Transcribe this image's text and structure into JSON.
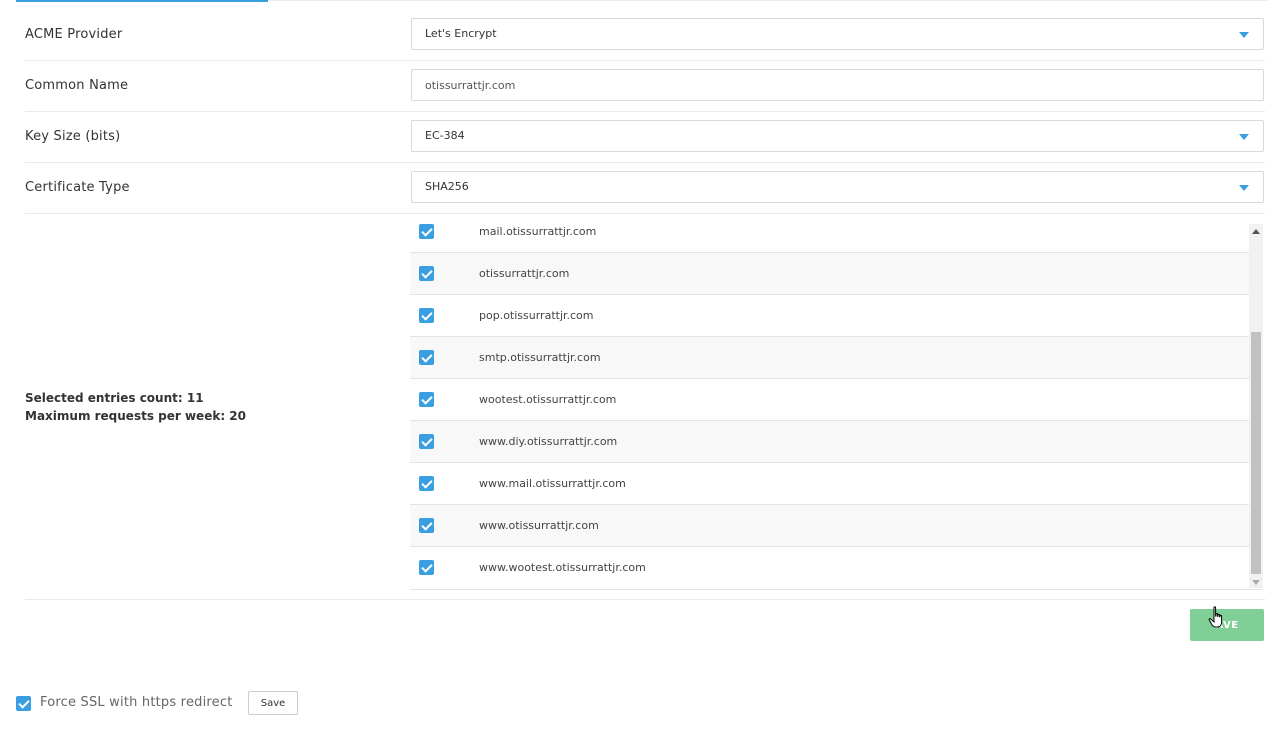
{
  "form": {
    "acme_provider": {
      "label": "ACME Provider",
      "value": "Let's Encrypt"
    },
    "common_name": {
      "label": "Common Name",
      "value": "otissurrattjr.com"
    },
    "key_size": {
      "label": "Key Size (bits)",
      "value": "EC-384"
    },
    "certificate_type": {
      "label": "Certificate Type",
      "value": "SHA256"
    }
  },
  "domains": {
    "selected_count_text": "Selected entries count: 11",
    "max_requests_text": "Maximum requests per week: 20",
    "items": [
      "mail.otissurrattjr.com",
      "otissurrattjr.com",
      "pop.otissurrattjr.com",
      "smtp.otissurrattjr.com",
      "wootest.otissurrattjr.com",
      "www.diy.otissurrattjr.com",
      "www.mail.otissurrattjr.com",
      "www.otissurrattjr.com",
      "www.wootest.otissurrattjr.com"
    ]
  },
  "actions": {
    "save_label": "AVE"
  },
  "footer": {
    "force_ssl_label": "Force SSL with https redirect",
    "save_label": "Save"
  },
  "colors": {
    "accent": "#3a9fe0",
    "save_green": "#7fcf96"
  }
}
